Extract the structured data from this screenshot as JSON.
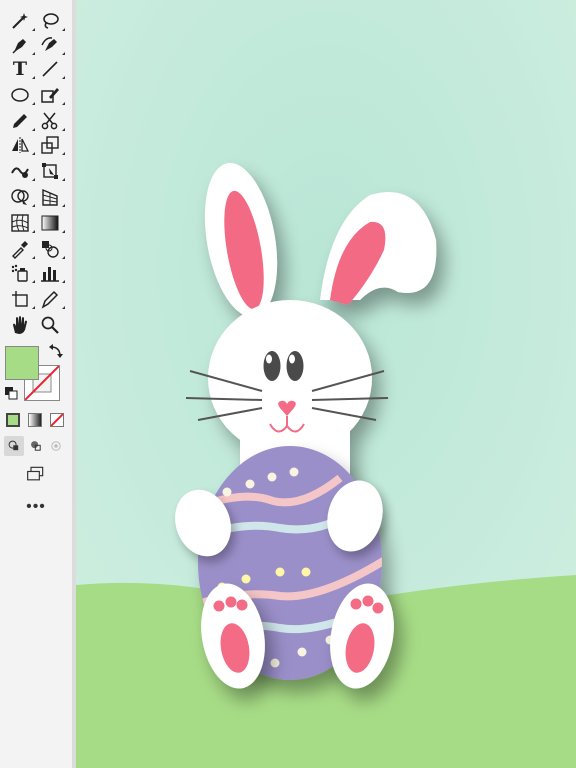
{
  "toolbar": {
    "tools": [
      {
        "name": "magic-wand-icon"
      },
      {
        "name": "lasso-icon"
      },
      {
        "name": "pen-icon"
      },
      {
        "name": "curvature-icon"
      },
      {
        "name": "type-icon",
        "label": "T"
      },
      {
        "name": "line-segment-icon"
      },
      {
        "name": "ellipse-icon"
      },
      {
        "name": "shaper-icon"
      },
      {
        "name": "pencil-icon"
      },
      {
        "name": "scissors-icon"
      },
      {
        "name": "reflect-icon"
      },
      {
        "name": "scale-icon"
      },
      {
        "name": "warp-icon"
      },
      {
        "name": "free-transform-icon"
      },
      {
        "name": "shape-builder-icon"
      },
      {
        "name": "perspective-grid-icon"
      },
      {
        "name": "mesh-icon"
      },
      {
        "name": "gradient-icon"
      },
      {
        "name": "eyedropper-icon"
      },
      {
        "name": "blend-icon"
      },
      {
        "name": "symbol-sprayer-icon"
      },
      {
        "name": "column-graph-icon"
      },
      {
        "name": "artboard-icon"
      },
      {
        "name": "slice-icon"
      },
      {
        "name": "hand-icon"
      },
      {
        "name": "zoom-icon"
      }
    ],
    "more_label": "•••",
    "fill_color": "#a7dc86",
    "stroke_color": "none"
  },
  "canvas": {
    "background_color": "#cfeee0",
    "grass_color": "#a7dc86",
    "bunny_color": "#ffffff",
    "inner_ear_color": "#f36b85",
    "egg_color": "#9b8fc9"
  }
}
